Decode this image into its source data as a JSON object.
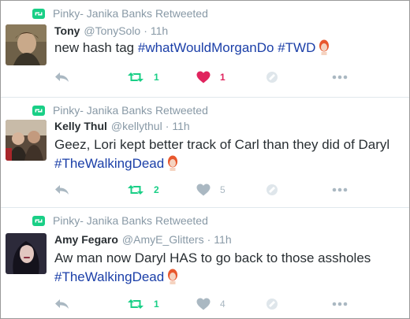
{
  "colors": {
    "retweet_green": "#19cf86",
    "like_red": "#e0245e",
    "hashtag_blue": "#1b3fa8",
    "muted_gray": "#8899a6"
  },
  "tweets": [
    {
      "retweeted_by": "Pinky- Janika Banks Retweeted",
      "name": "Tony",
      "handle": "@TonySolo",
      "time": "11h",
      "text_plain": "new hash tag ",
      "tag1": "#whatWouldMorganDo",
      "tag2": "#TWD",
      "retweets": "1",
      "likes": "1",
      "liked": true,
      "retweeted": true
    },
    {
      "retweeted_by": "Pinky- Janika Banks Retweeted",
      "name": "Kelly Thul",
      "handle": "@kellythul",
      "time": "11h",
      "text_plain": "Geez, Lori kept better track of Carl than they did of Daryl",
      "tag1": "#TheWalkingDead",
      "retweets": "2",
      "likes": "5",
      "liked": false,
      "retweeted": true
    },
    {
      "retweeted_by": "Pinky- Janika Banks Retweeted",
      "name": "Amy Fegaro",
      "handle": "@AmyE_Glitters",
      "time": "11h",
      "text_plain": "Aw man now Daryl HAS to go back to those assholes",
      "tag1": "#TheWalkingDead",
      "retweets": "1",
      "likes": "4",
      "liked": false,
      "retweeted": true
    }
  ],
  "icons": {
    "retweet": "retweet-icon",
    "reply": "reply-icon",
    "like": "heart-icon",
    "extension": "extension-icon",
    "more": "more-dots-icon",
    "emoji": "daryl-head-emoji-icon"
  }
}
